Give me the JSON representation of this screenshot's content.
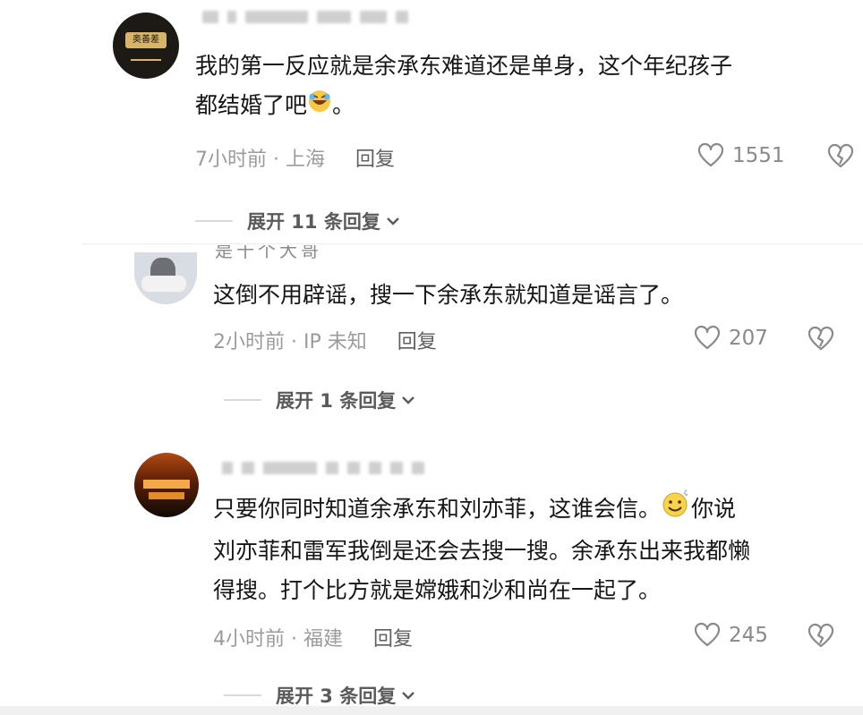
{
  "comments": [
    {
      "username_hidden": "",
      "avatar_text": "奥善差",
      "text_line1": "我的第一反应就是余承东难道还是单身，这个年纪孩子",
      "text_line2_pre": "都结婚了吧",
      "text_line2_post": "。",
      "time_location": "7小时前 · 上海",
      "reply_label": "回复",
      "likes": "1551",
      "expand_label": "展开 11 条回复"
    },
    {
      "username_partial": "是十个大哥",
      "text_line1": "这倒不用辟谣，搜一下余承东就知道是谣言了。",
      "time_location": "2小时前 · IP 未知",
      "reply_label": "回复",
      "likes": "207",
      "expand_label": "展开 1 条回复"
    },
    {
      "text_line1_pre": "只要你同时知道余承东和刘亦菲，这谁会信。",
      "text_line1_post": "你说",
      "text_line2": "刘亦菲和雷军我倒是还会去搜一搜。余承东出来我都懒",
      "text_line3": "得搜。打个比方就是嫦娥和沙和尚在一起了。",
      "time_location": "4小时前 · 福建",
      "reply_label": "回复",
      "likes": "245",
      "expand_label": "展开 3 条回复"
    }
  ],
  "icons": {
    "like": "heart-outline-icon",
    "dislike": "broken-heart-icon",
    "expand": "chevron-down-icon"
  },
  "colors": {
    "text": "#161616",
    "meta": "#9b9b9b",
    "divider": "#ececec"
  }
}
